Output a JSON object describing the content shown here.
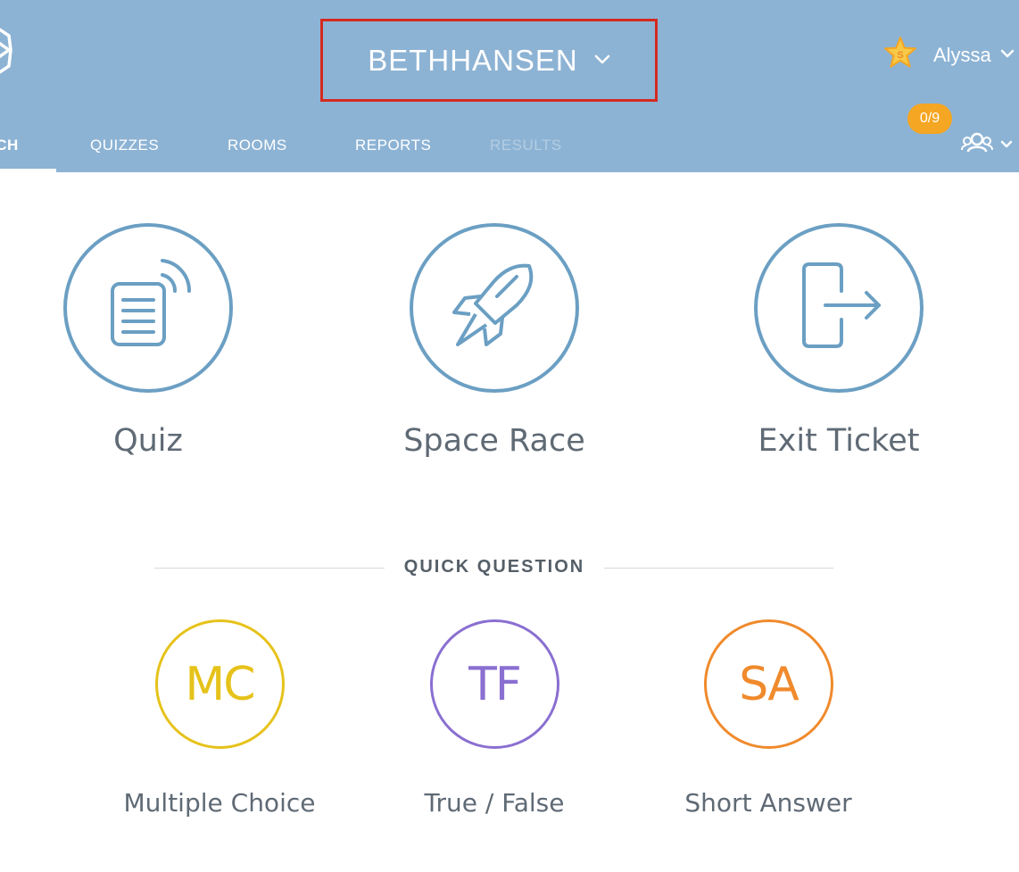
{
  "header": {
    "room_name": "BETHHANSEN",
    "user_name": "Alyssa",
    "student_count": "0/9"
  },
  "nav": {
    "launch": "ICH",
    "quizzes": "QUIZZES",
    "rooms": "ROOMS",
    "reports": "REPORTS",
    "results": "RESULTS"
  },
  "activities": {
    "quiz": "Quiz",
    "space_race": "Space Race",
    "exit_ticket": "Exit Ticket"
  },
  "quick_question": {
    "title": "QUICK QUESTION",
    "mc": {
      "abbr": "MC",
      "label": "Multiple Choice",
      "color": "#e6c21a"
    },
    "tf": {
      "abbr": "TF",
      "label": "True / False",
      "color": "#8a6fd1"
    },
    "sa": {
      "abbr": "SA",
      "label": "Short Answer",
      "color": "#f08a2c"
    }
  },
  "colors": {
    "header_bg": "#8db3d4",
    "accent": "#6b9fc3",
    "highlight_border": "#d42a20",
    "badge": "#f5a623"
  },
  "icons": [
    "logo-icon",
    "chevron-down-icon",
    "star-icon",
    "group-icon",
    "quiz-icon",
    "rocket-icon",
    "exit-icon"
  ]
}
